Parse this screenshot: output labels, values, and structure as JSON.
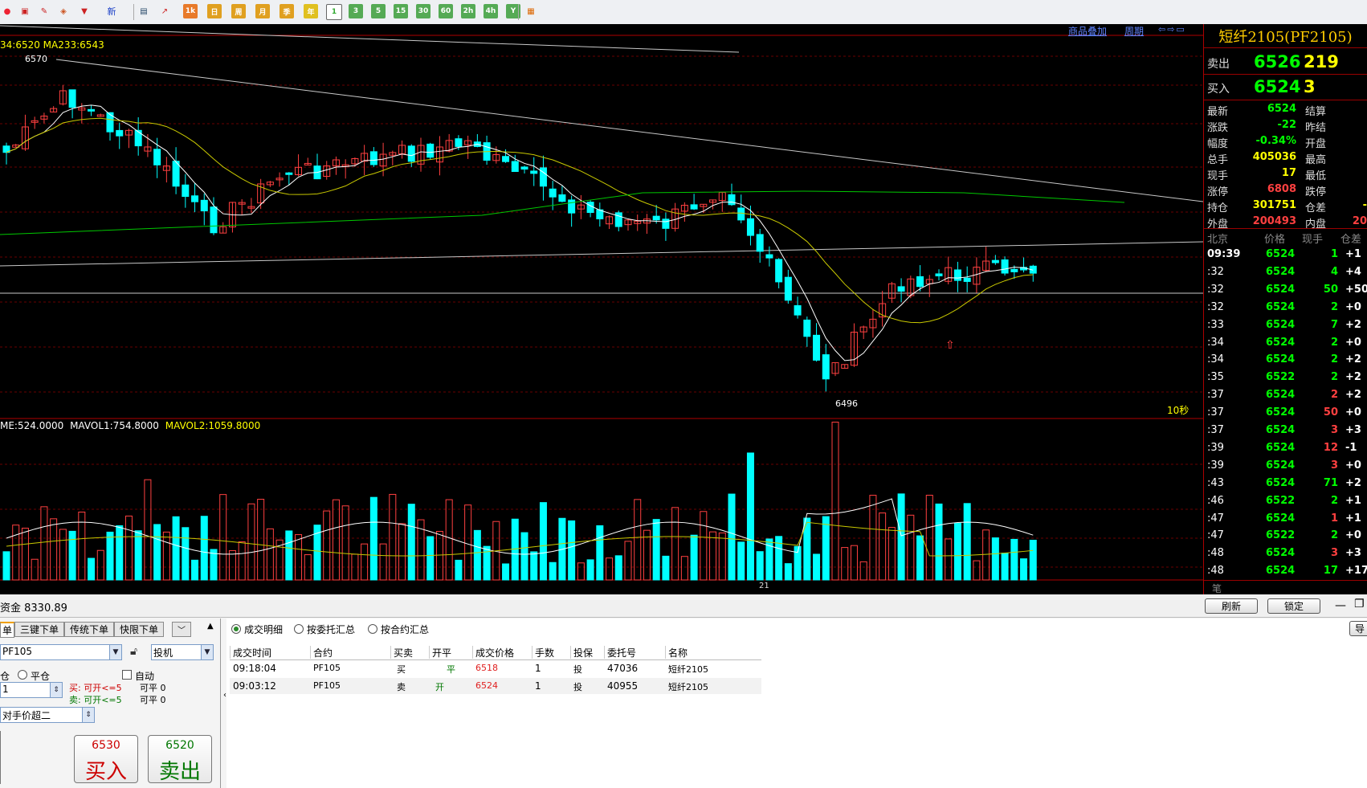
{
  "toolbar": {
    "new_label": "新",
    "period_buttons": [
      "1k",
      "日",
      "周",
      "月",
      "季",
      "年",
      "1",
      "3",
      "5",
      "15",
      "30",
      "60",
      "2h",
      "4h",
      "Y"
    ]
  },
  "chart": {
    "ma_legend": "34:6520 MA233:6543",
    "high_label": "6570",
    "low_label": "6496",
    "interval_label": "10秒",
    "link_overlay": "商品叠加",
    "link_period": "周期",
    "vol_legend_vol": "ME:524.0000",
    "vol_legend_mavol1": "MAVOL1:754.8000",
    "vol_legend_mavol2": "MAVOL2:1059.8000",
    "x_tick": "21",
    "colors": {
      "up": "#ff4040",
      "down": "#00ffff",
      "ma_short": "#ffffff",
      "ma_mid": "#c8c800",
      "ma_long": "#00c800"
    }
  },
  "quote": {
    "title": "短纤2105(PF2105)",
    "sell_label": "卖出",
    "sell_price": "6526",
    "sell_qty": "219",
    "buy_label": "买入",
    "buy_price": "6524",
    "buy_qty": "3",
    "rows": [
      {
        "l1": "最新",
        "v1": "6524",
        "l2": "结算",
        "v2": "",
        "c": "#00ff00"
      },
      {
        "l1": "涨跌",
        "v1": "-22",
        "l2": "昨结",
        "v2": "",
        "c": "#00ff00"
      },
      {
        "l1": "幅度",
        "v1": "-0.34%",
        "l2": "开盘",
        "v2": "",
        "c": "#00ff00"
      },
      {
        "l1": "总手",
        "v1": "405036",
        "l2": "最高",
        "v2": "",
        "c": "#ffff00"
      },
      {
        "l1": "现手",
        "v1": "17",
        "l2": "最低",
        "v2": "",
        "c": "#ffff00"
      },
      {
        "l1": "涨停",
        "v1": "6808",
        "l2": "跌停",
        "v2": "",
        "c": "#ff4040"
      },
      {
        "l1": "持仓",
        "v1": "301751",
        "l2": "仓差",
        "v2": "-",
        "c": "#ffff00"
      },
      {
        "l1": "外盘",
        "v1": "200493",
        "l2": "内盘",
        "v2": "20",
        "c": "#ff4040"
      }
    ],
    "tick_header": {
      "time": "北京",
      "price": "价格",
      "qty": "现手",
      "oi": "仓差"
    },
    "ticks": [
      {
        "t": "09:39",
        "p": "6524",
        "q": "1",
        "o": "+1",
        "qc": "#00ff00"
      },
      {
        "t": ":32",
        "p": "6524",
        "q": "4",
        "o": "+4",
        "qc": "#00ff00"
      },
      {
        "t": ":32",
        "p": "6524",
        "q": "50",
        "o": "+50",
        "qc": "#00ff00"
      },
      {
        "t": ":32",
        "p": "6524",
        "q": "2",
        "o": "+0",
        "qc": "#00ff00"
      },
      {
        "t": ":33",
        "p": "6524",
        "q": "7",
        "o": "+2",
        "qc": "#00ff00"
      },
      {
        "t": ":34",
        "p": "6524",
        "q": "2",
        "o": "+0",
        "qc": "#00ff00"
      },
      {
        "t": ":34",
        "p": "6524",
        "q": "2",
        "o": "+2",
        "qc": "#00ff00"
      },
      {
        "t": ":35",
        "p": "6522",
        "q": "2",
        "o": "+2",
        "qc": "#00ff00"
      },
      {
        "t": ":37",
        "p": "6524",
        "q": "2",
        "o": "+2",
        "qc": "#ff4040"
      },
      {
        "t": ":37",
        "p": "6524",
        "q": "50",
        "o": "+0",
        "qc": "#ff4040"
      },
      {
        "t": ":37",
        "p": "6524",
        "q": "3",
        "o": "+3",
        "qc": "#ff4040"
      },
      {
        "t": ":39",
        "p": "6524",
        "q": "12",
        "o": "-1",
        "qc": "#ff4040"
      },
      {
        "t": ":39",
        "p": "6524",
        "q": "3",
        "o": "+0",
        "qc": "#ff4040"
      },
      {
        "t": ":43",
        "p": "6524",
        "q": "71",
        "o": "+2",
        "qc": "#00ff00"
      },
      {
        "t": ":46",
        "p": "6522",
        "q": "2",
        "o": "+1",
        "qc": "#00ff00"
      },
      {
        "t": ":47",
        "p": "6524",
        "q": "1",
        "o": "+1",
        "qc": "#ff4040"
      },
      {
        "t": ":47",
        "p": "6522",
        "q": "2",
        "o": "+0",
        "qc": "#00ff00"
      },
      {
        "t": ":48",
        "p": "6524",
        "q": "3",
        "o": "+3",
        "qc": "#ff4040"
      },
      {
        "t": ":48",
        "p": "6524",
        "q": "17",
        "o": "+17",
        "qc": "#00ff00"
      }
    ],
    "footer": "笔"
  },
  "trade": {
    "funds": "资金 8330.89",
    "btn_refresh": "刷新",
    "btn_lock": "锁定",
    "btn_export": "导",
    "tabs": [
      "单",
      "三键下单",
      "传统下单",
      "快限下单"
    ],
    "contract": "PF105",
    "hedge": "投机",
    "open_label": "仓",
    "close_label": "平仓",
    "auto_label": "自动",
    "qty": "1",
    "buy_can_open": "买: 可开<=5",
    "buy_can_close": "可平 0",
    "sell_can_open": "卖: 可开<=5",
    "sell_can_close": "可平 0",
    "price_type": "对手价超二",
    "buy_price": "6530",
    "buy_label": "买入",
    "sell_price": "6520",
    "sell_label": "卖出",
    "views": [
      "成交明细",
      "按委托汇总",
      "按合约汇总"
    ],
    "columns": [
      "成交时间",
      "合约",
      "买卖",
      "开平",
      "成交价格",
      "手数",
      "投保",
      "委托号",
      "名称"
    ],
    "rows": [
      {
        "time": "09:18:04",
        "code": "PF105",
        "side": "买",
        "oc": "平",
        "price": "6518",
        "qty": "1",
        "hedge": "投",
        "order": "47036",
        "name": "短纤2105"
      },
      {
        "time": "09:03:12",
        "code": "PF105",
        "side": "卖",
        "oc": "开",
        "price": "6524",
        "qty": "1",
        "hedge": "投",
        "order": "40955",
        "name": "短纤2105"
      }
    ]
  }
}
